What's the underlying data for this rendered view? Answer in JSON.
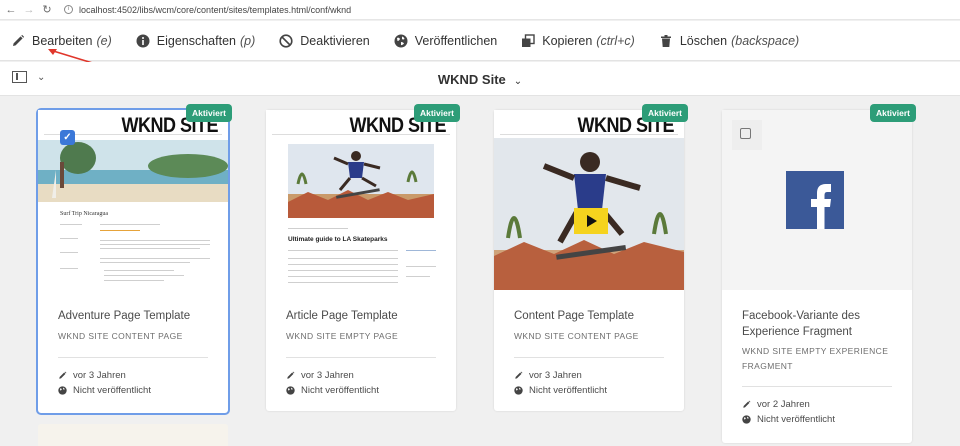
{
  "browser": {
    "url": "localhost:4502/libs/wcm/core/content/sites/templates.html/conf/wknd"
  },
  "actions": [
    {
      "label": "Bearbeiten",
      "shortcut": "(e)",
      "icon": "pencil-icon"
    },
    {
      "label": "Eigenschaften",
      "shortcut": "(p)",
      "icon": "info-icon"
    },
    {
      "label": "Deaktivieren",
      "shortcut": "",
      "icon": "disable-icon"
    },
    {
      "label": "Veröffentlichen",
      "shortcut": "",
      "icon": "globe-icon"
    },
    {
      "label": "Kopieren",
      "shortcut": "(ctrl+c)",
      "icon": "copy-icon"
    },
    {
      "label": "Löschen",
      "shortcut": "(backspace)",
      "icon": "trash-icon"
    }
  ],
  "titlebar": {
    "title": "WKND Site"
  },
  "colors": {
    "badge": "#2d9d78",
    "selection": "#6f9de8",
    "checkbox": "#3b78d8",
    "annotation_arrow": "#e0362b"
  },
  "cards": [
    {
      "badge": "Aktiviert",
      "title": "Adventure Page Template",
      "subtitle": "WKND SITE CONTENT PAGE",
      "modified": "vor 3 Jahren",
      "status": "Nicht veröffentlicht",
      "logo": "WKND SITE",
      "article_heading": "Surf Trip Nicaragua",
      "selected": true
    },
    {
      "badge": "Aktiviert",
      "title": "Article Page Template",
      "subtitle": "WKND SITE EMPTY PAGE",
      "modified": "vor 3 Jahren",
      "status": "Nicht veröffentlicht",
      "logo": "WKND SITE",
      "article_heading": "Ultimate guide to LA Skateparks",
      "selected": false
    },
    {
      "badge": "Aktiviert",
      "title": "Content Page Template",
      "subtitle": "WKND SITE CONTENT PAGE",
      "modified": "vor 3 Jahren",
      "status": "Nicht veröffentlicht",
      "logo": "WKND SITE",
      "selected": false
    },
    {
      "badge": "Aktiviert",
      "title": "Facebook-Variante des Experience Fragment",
      "subtitle": "WKND SITE EMPTY EXPERIENCE FRAGMENT",
      "modified": "vor 2 Jahren",
      "status": "Nicht veröffentlicht",
      "thumb_icon": "facebook-icon",
      "selected": false
    }
  ]
}
